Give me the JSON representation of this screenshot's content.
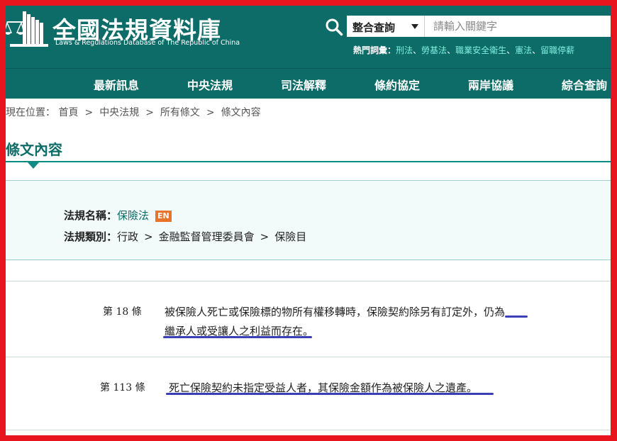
{
  "header": {
    "title": "全國法規資料庫",
    "subtitle": "Laws & Regulations Database of The Republic of China",
    "search": {
      "select_label": "整合查詢",
      "placeholder": "請輸入關鍵字"
    },
    "hot_keywords_label": "熱門詞彙：",
    "hot_keywords": [
      "刑法",
      "勞基法",
      "職業安全衛生",
      "憲法",
      "留職停薪"
    ],
    "hot_separator": "、"
  },
  "nav": {
    "items": [
      "最新訊息",
      "中央法規",
      "司法解釋",
      "條約協定",
      "兩岸協議",
      "綜合查詢"
    ]
  },
  "breadcrumb": {
    "label": "現在位置：",
    "items": [
      "首頁",
      "中央法規",
      "所有條文",
      "條文內容"
    ],
    "separator": ">"
  },
  "page_title": "條文內容",
  "law_info": {
    "name_label": "法規名稱：",
    "name_value": "保險法",
    "en_badge": "EN",
    "category_label": "法規類別：",
    "category_path": [
      "行政",
      "金融監督管理委員會",
      "保險目"
    ],
    "category_separator": ">"
  },
  "articles": [
    {
      "label": "第 18 條",
      "line1": "被保險人死亡或保險標的物所有權移轉時，保險契約除另有訂定外，仍為",
      "line2": "繼承人或受讓人之利益而存在。"
    },
    {
      "label": "第 113 條",
      "line1": "死亡保險契約未指定受益人者，其保險金額作為被保險人之遺產。"
    }
  ],
  "colors": {
    "brand": "#0e6c68",
    "frame": "#e8141e",
    "hot_link": "#7ff0df",
    "badge": "#e8742a",
    "annotation": "#3a3fb8"
  }
}
